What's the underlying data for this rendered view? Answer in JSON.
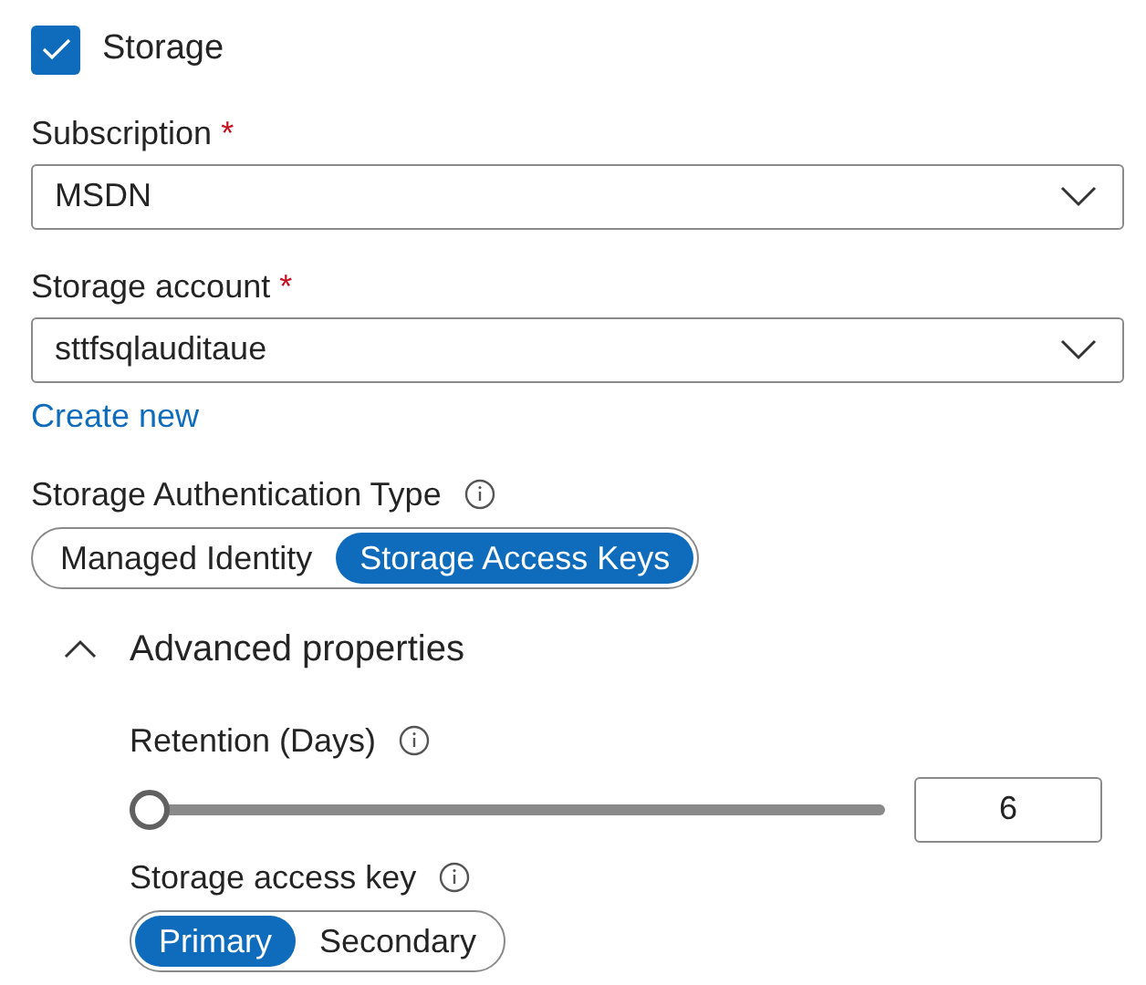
{
  "storage_checkbox": {
    "label": "Storage",
    "checked": true
  },
  "fields": [
    {
      "label": "Subscription",
      "required_mark": "*",
      "value": "MSDN"
    },
    {
      "label": "Storage account",
      "required_mark": "*",
      "value": "sttfsqlauditaue"
    }
  ],
  "create_link": "Create new",
  "auth_type": {
    "label": "Storage Authentication Type",
    "options": [
      {
        "label": "Managed Identity",
        "selected": false
      },
      {
        "label": "Storage Access Keys",
        "selected": true
      }
    ]
  },
  "advanced": {
    "label": "Advanced properties",
    "expanded": true,
    "retention": {
      "label": "Retention (Days)",
      "level": 0,
      "value": "6"
    },
    "access_key": {
      "label": "Storage access key",
      "options": [
        {
          "label": "Primary",
          "selected": true
        },
        {
          "label": "Secondary",
          "selected": false
        }
      ]
    }
  }
}
